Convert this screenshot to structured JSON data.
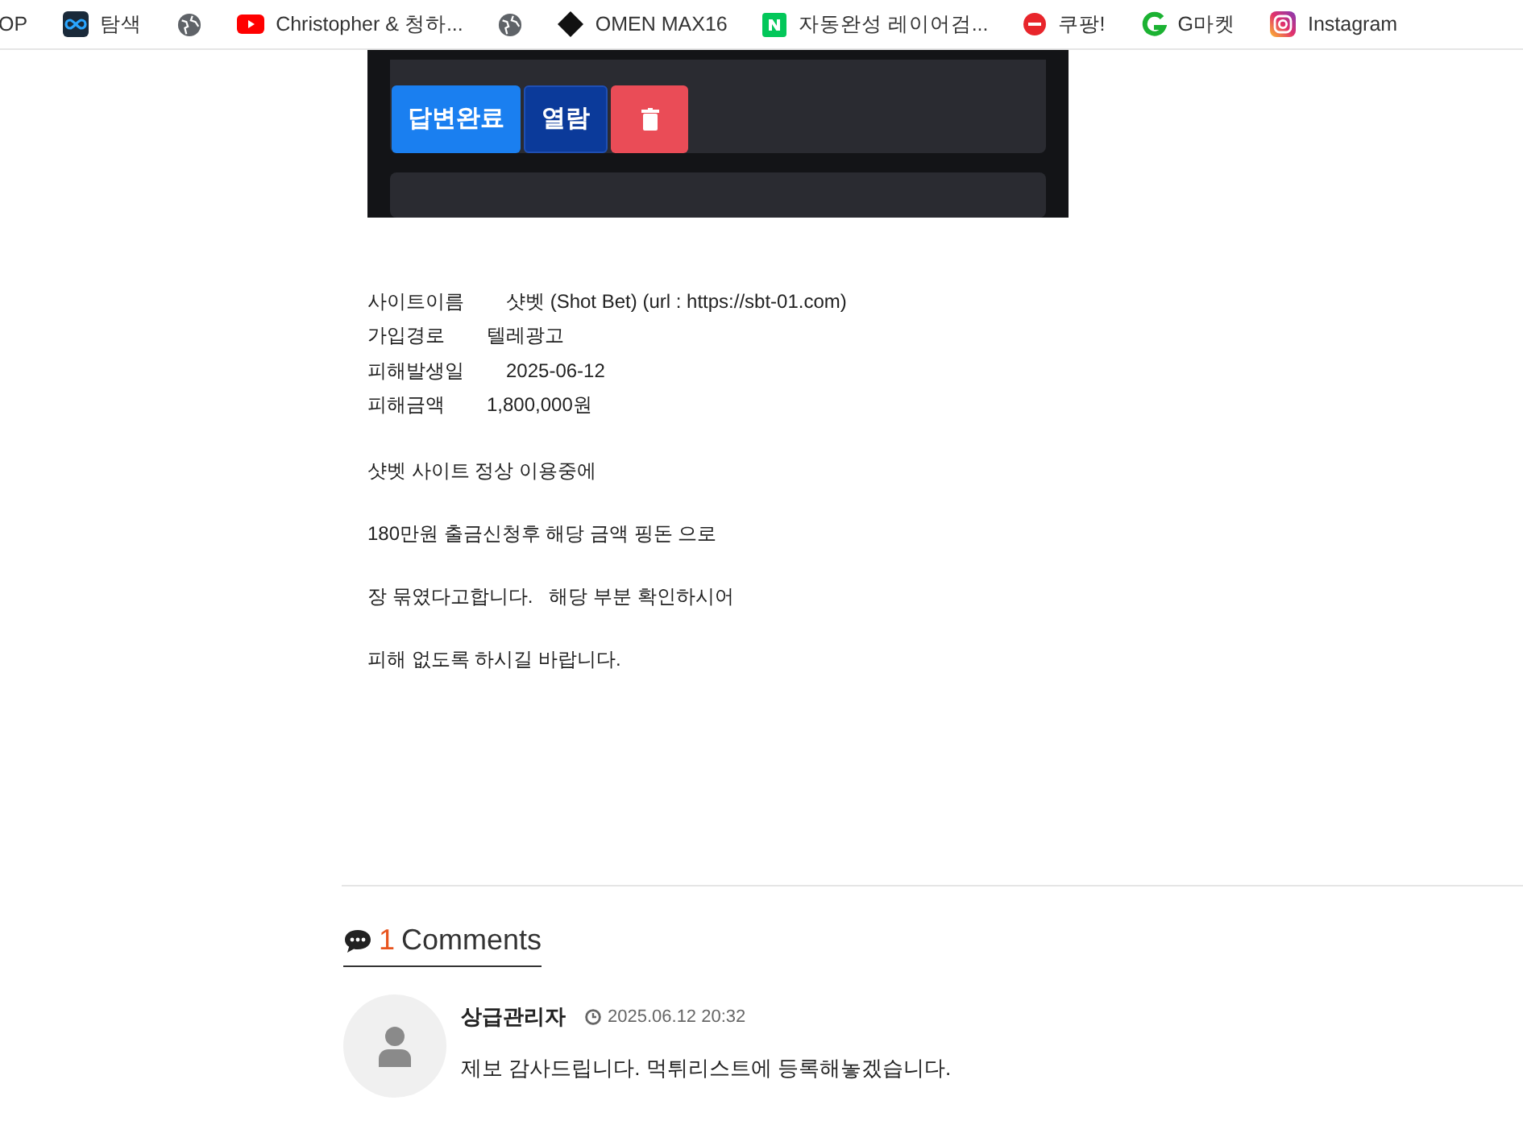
{
  "bookmarks": [
    {
      "label": "OP",
      "kind": "none"
    },
    {
      "label": "탐색",
      "kind": "infinity"
    },
    {
      "kind": "globe"
    },
    {
      "label": "Christopher & 청하...",
      "kind": "play"
    },
    {
      "kind": "globe"
    },
    {
      "label": "OMEN MAX16",
      "kind": "diamond"
    },
    {
      "label": "자동완성 레이어검...",
      "kind": "n-logo"
    },
    {
      "label": "쿠팡!",
      "kind": "red-dot"
    },
    {
      "label": "G마켓",
      "kind": "g-logo"
    },
    {
      "label": "Instagram",
      "kind": "camera"
    }
  ],
  "embedded_screenshot": {
    "buttons": [
      {
        "label": "답변완료",
        "kind": "primary"
      },
      {
        "label": "열람",
        "kind": "dark"
      },
      {
        "kind": "delete"
      }
    ]
  },
  "info": [
    {
      "label": "사이트이름",
      "value": "샷벳 (Shot Bet) (url : https://sbt-01.com)"
    },
    {
      "label": "가입경로",
      "value": "텔레광고"
    },
    {
      "label": "피해발생일",
      "value": "2025-06-12"
    },
    {
      "label": "피해금액",
      "value": "1,800,000원"
    }
  ],
  "paragraphs": [
    "샷벳 사이트 정상 이용중에",
    "180만원 출금신청후 해당 금액 핑돈 으로",
    "장 묶였다고합니다.   해당 부분 확인하시어",
    "피해 없도록 하시길 바랍니다."
  ],
  "comments_header": {
    "count": "1",
    "label": "Comments"
  },
  "comments": [
    {
      "author": "상급관리자",
      "time": "2025.06.12 20:32",
      "text": "제보 감사드립니다. 먹튀리스트에 등록해놓겠습니다."
    }
  ]
}
